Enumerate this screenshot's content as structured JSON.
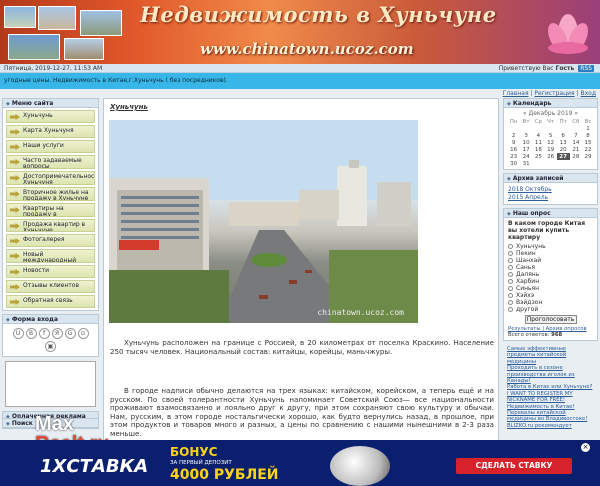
{
  "header": {
    "title": "Недвижимость в Хуньчуне",
    "url": "www.chinatown.ucoz.com"
  },
  "infobar": {
    "date": "Пятница, 2019-12-27, 11:53 AM",
    "greeting": "Приветствую Вас",
    "user": "Гость",
    "rss": "RSS"
  },
  "marquee": "угодные цены. Недвижимость в Китае,г.Хуньчунь ( без посредников).",
  "toplinks": [
    "Главная",
    "Регистрация",
    "Вход"
  ],
  "left_menu": {
    "heading": "Меню сайта",
    "items": [
      "Хуньчунь",
      "Карта Хуньчуня",
      "Наши услуги",
      "Часто задаваемые вопросы",
      "Достопримечательности Хуньчуня",
      "Вторичное жилье на продажу в Хуньчуне",
      "Квартиры на продажу в новостройках в Хуньчуне",
      "Продажа квартир в Хуньчуне",
      "Фотогалерея",
      "Новый международный автовокзал в Хуньчуне",
      "Новости",
      "Отзывы клиентов",
      "Обратная связь"
    ]
  },
  "login": {
    "heading": "Форма входа",
    "icons": [
      "U",
      "В",
      "f",
      "Я",
      "G",
      "⊙",
      "▣"
    ]
  },
  "ad_heading": "Оплаченная реклама",
  "search_heading": "Поиск",
  "main": {
    "breadcrumb": "Хуньчунь",
    "watermark": "chinatown.ucoz.com",
    "para1": "Хуньчунь расположен на границе с Россией, в 20 километрах от поселка Краскино. Население 250 тысяч человек. Национальный состав: китайцы, корейцы, маньчжуры.",
    "para2": "В городе надписи обычно делаются на трех языках: китайском, корейском, а теперь ещё и на русском. По своей толерантности Хуньчунь напоминает Советский Союз— все национальности проживают взамосвязанно и лояльно друг к другу, при этом сохраняют свою культуру и обычаи. Нам, русским, в этом городе ностальгически хорошо, как будто вернулись назад, в прошлое, при этом продуктов и товаров много и разных, а цены по сравнению с нашими нынешними в 2-3 раза меньше."
  },
  "calendar": {
    "heading": "Календарь",
    "month": "« Декабрь 2019 »",
    "weekdays": [
      "Пн",
      "Вт",
      "Ср",
      "Чт",
      "Пт",
      "Сб",
      "Вс"
    ],
    "weeks": [
      [
        "",
        "",
        "",
        "",
        "",
        "",
        "1"
      ],
      [
        "2",
        "3",
        "4",
        "5",
        "6",
        "7",
        "8"
      ],
      [
        "9",
        "10",
        "11",
        "12",
        "13",
        "14",
        "15"
      ],
      [
        "16",
        "17",
        "18",
        "19",
        "20",
        "21",
        "22"
      ],
      [
        "23",
        "24",
        "25",
        "26",
        "27",
        "28",
        "29"
      ],
      [
        "30",
        "31",
        "",
        "",
        "",
        "",
        ""
      ]
    ],
    "today": "27"
  },
  "archive": {
    "heading": "Архив записей",
    "items": [
      "2018 Октябрь",
      "2015 Апрель"
    ]
  },
  "poll": {
    "heading": "Наш опрос",
    "question": "В каком городе Китая вы хотели купить квартиру",
    "options": [
      "Хуньчунь",
      "Пекин",
      "Шанхай",
      "Санья",
      "Далянь",
      "Харбин",
      "Синьян",
      "Хэйхэ",
      "Вэйдзон",
      "другой"
    ],
    "button": "Проголосовать",
    "results": "Результаты",
    "archive": "Архив опросов",
    "total_label": "Всего ответов:",
    "total": "968"
  },
  "right_ads": [
    "Самые эффективные предметы китайской медицины",
    "Проходить в сезоне производства иголок из Канады!",
    "Работа в Китае или Хуньчуне?",
    "I WANT TO REGISTER MY NICKNAME FOR FREE!",
    "Недвижимость в Китае!",
    "Перевалы китайской медицины во Владивостоке!"
  ],
  "blizko": "BLIZKO.ru рекомендует",
  "adbar": {
    "logo": "1XСТАВКА",
    "bonus_title": "БОНУС",
    "bonus_text": "ЗА ПЕРВЫЙ ДЕПОЗИТ",
    "amount": "4000 РУБЛЕЙ",
    "cta": "СДЕЛАТЬ СТАВКУ",
    "close": "×"
  },
  "watermark": {
    "line1": "Max",
    "line2": "Realt.ru"
  }
}
